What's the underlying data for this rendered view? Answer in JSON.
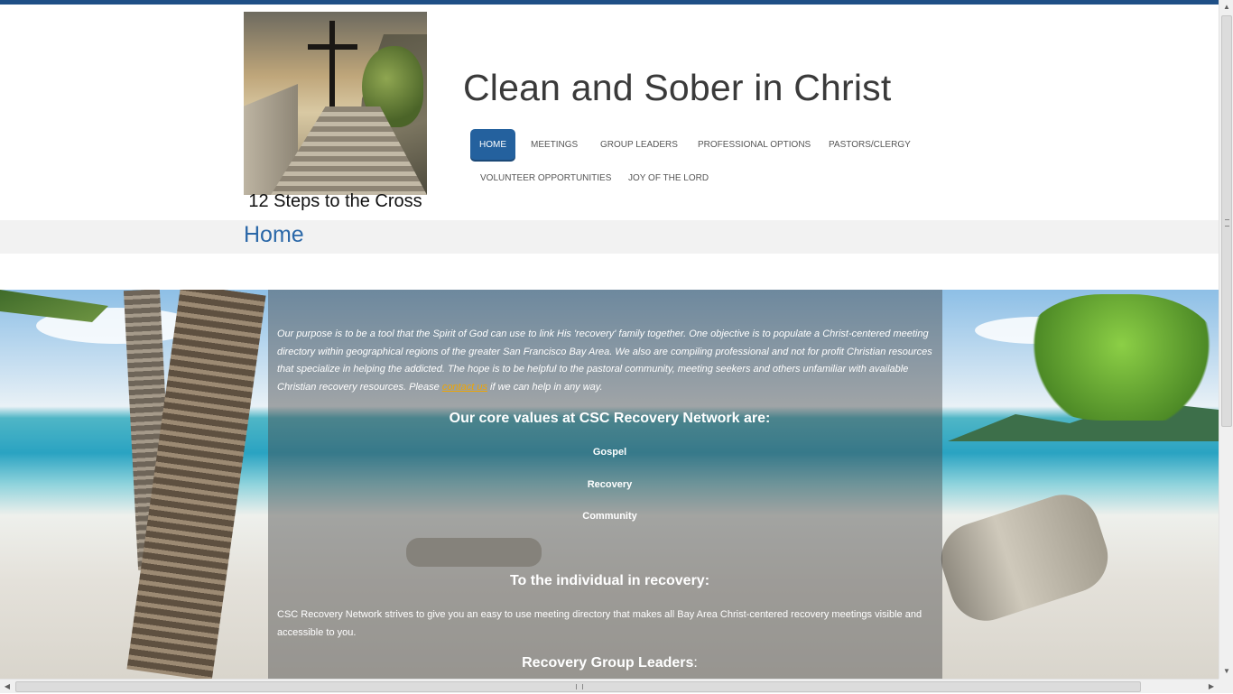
{
  "header": {
    "logo_caption": "12 Steps to the Cross",
    "site_title": "Clean and Sober in Christ"
  },
  "nav": {
    "items": [
      {
        "label": "Home",
        "active": true
      },
      {
        "label": "Meetings",
        "active": false
      },
      {
        "label": "Group Leaders",
        "active": false
      },
      {
        "label": "Professional Options",
        "active": false
      },
      {
        "label": "Pastors/Clergy",
        "active": false
      },
      {
        "label": "Volunteer Opportunities",
        "active": false
      },
      {
        "label": "Joy of the Lord",
        "active": false
      }
    ]
  },
  "page": {
    "title": "Home"
  },
  "content": {
    "intro_text": "Our purpose is to be a tool that the Spirit of God can use to link His 'recovery' family together. One objective is to populate a Christ-centered meeting directory within geographical regions of the greater San Francisco Bay Area. We also are compiling professional and not for profit Christian resources that specialize in helping the addicted. The hope is to be helpful to the pastoral community, meeting seekers and others unfamiliar with available Christian recovery resources. Please",
    "contact_link": "contact us",
    "intro_suffix": "if we can help in any way.",
    "core_values_title": "Our core values at CSC Recovery Network are:",
    "core_values": [
      "Gospel",
      "Recovery",
      "Community"
    ],
    "individual_title": "To the individual in recovery:",
    "individual_text": "CSC Recovery Network strives to give you an easy to use meeting directory that makes all Bay Area Christ-centered recovery meetings visible and accessible to you.",
    "leaders_title": "Recovery Group Leaders",
    "leaders_title_suffix": ":"
  },
  "colors": {
    "accent": "#24619e",
    "top_bar": "#1f4f86",
    "link": "#f0a500",
    "page_title": "#2b68a8"
  },
  "icons": {
    "scroll_up": "scroll-up-arrow-icon",
    "scroll_down": "scroll-down-arrow-icon",
    "scroll_left": "scroll-left-arrow-icon",
    "scroll_right": "scroll-right-arrow-icon"
  }
}
